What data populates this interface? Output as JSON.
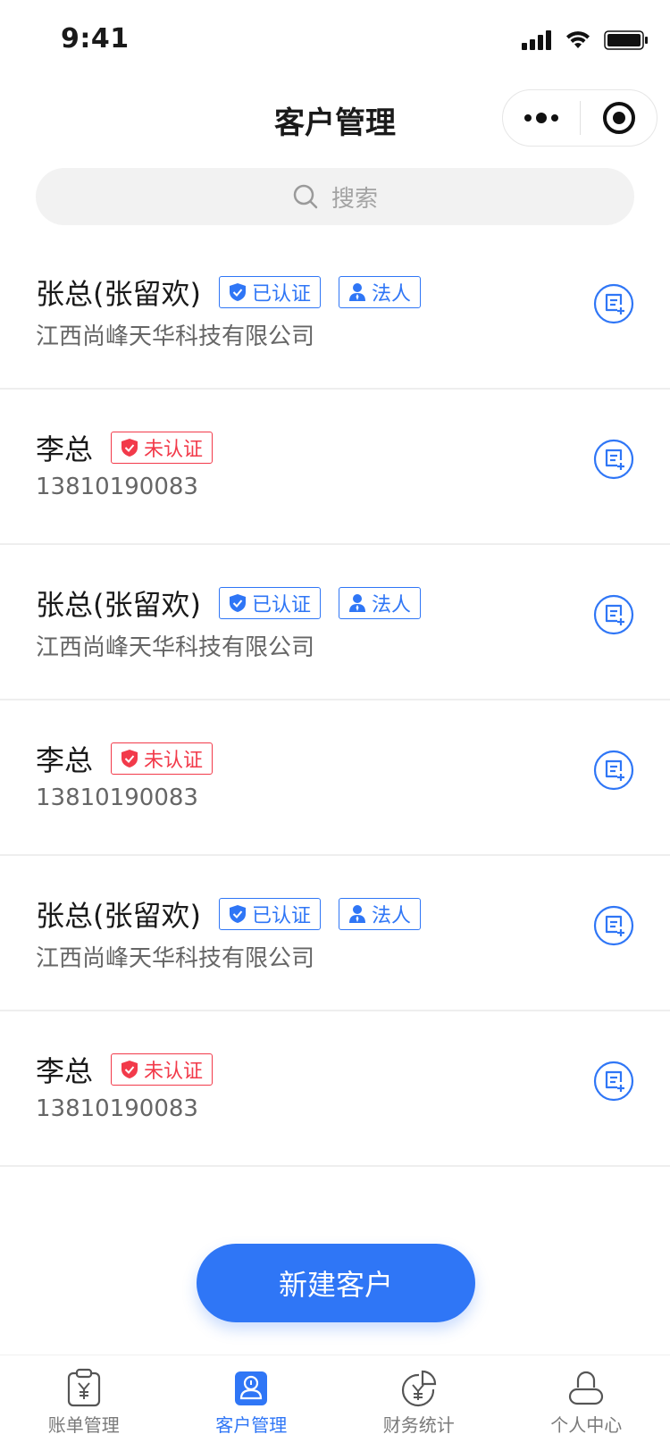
{
  "status_bar": {
    "time": "9:41"
  },
  "nav": {
    "title": "客户管理"
  },
  "search": {
    "placeholder": "搜索"
  },
  "customers": [
    {
      "name": "张总(张留欢)",
      "sub": "江西尚峰天华科技有限公司",
      "status": "已认证",
      "status_type": "verified",
      "role": "法人"
    },
    {
      "name": "李总",
      "sub": "13810190083",
      "status": "未认证",
      "status_type": "unverified",
      "role": ""
    },
    {
      "name": "张总(张留欢)",
      "sub": "江西尚峰天华科技有限公司",
      "status": "已认证",
      "status_type": "verified",
      "role": "法人"
    },
    {
      "name": "李总",
      "sub": "13810190083",
      "status": "未认证",
      "status_type": "unverified",
      "role": ""
    },
    {
      "name": "张总(张留欢)",
      "sub": "江西尚峰天华科技有限公司",
      "status": "已认证",
      "status_type": "verified",
      "role": "法人"
    },
    {
      "name": "李总",
      "sub": "13810190083",
      "status": "未认证",
      "status_type": "unverified",
      "role": ""
    }
  ],
  "new_button": {
    "label": "新建客户"
  },
  "tab_bar": {
    "tabs": [
      {
        "label": "账单管理",
        "icon": "bill-icon",
        "active": false
      },
      {
        "label": "客户管理",
        "icon": "customer-icon",
        "active": true
      },
      {
        "label": "财务统计",
        "icon": "finance-icon",
        "active": false
      },
      {
        "label": "个人中心",
        "icon": "profile-icon",
        "active": false
      }
    ]
  },
  "colors": {
    "primary": "#2f76f6",
    "danger": "#f23a4a",
    "text": "#1a1a1a",
    "subtext": "#666666"
  }
}
